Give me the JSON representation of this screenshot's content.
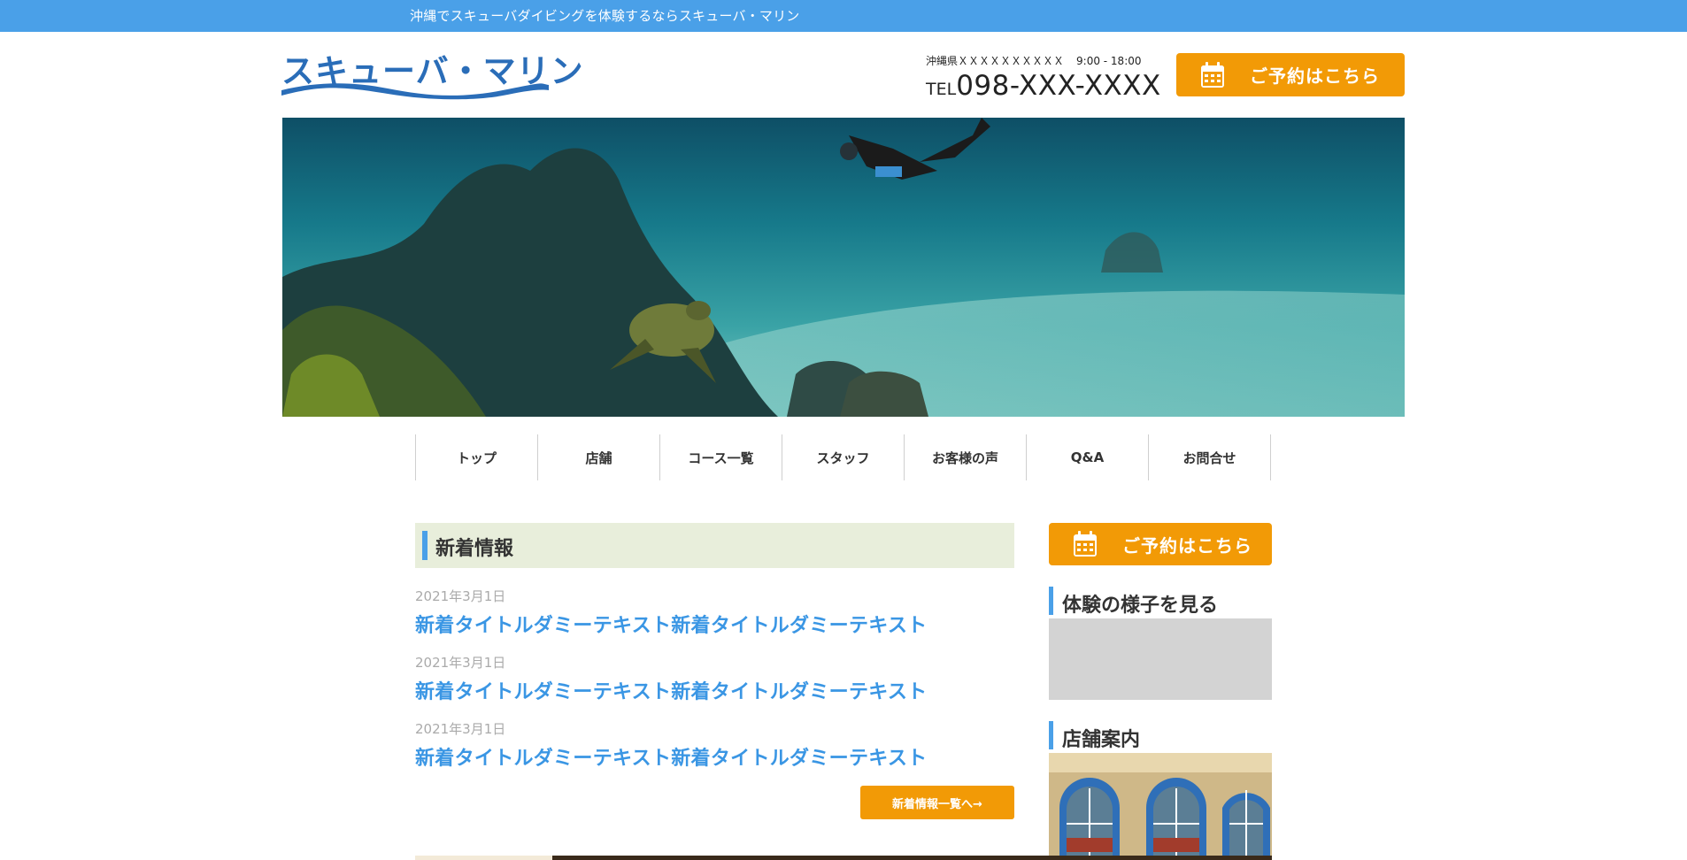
{
  "topbar": {
    "text": "沖縄でスキューバダイビングを体験するならスキューバ・マリン"
  },
  "logo": {
    "text": "スキューバ・マリン"
  },
  "header": {
    "address": "沖縄県ＸＸＸＸＸＸＸＸＸＸ",
    "hours": "9:00 - 18:00",
    "tel_label": "TEL",
    "tel_number": "098-XXX-XXXX",
    "reserve_label": "ご予約はこちら"
  },
  "nav": {
    "items": [
      {
        "label": "トップ"
      },
      {
        "label": "店舗"
      },
      {
        "label": "コース一覧"
      },
      {
        "label": "スタッフ"
      },
      {
        "label": "お客様の声"
      },
      {
        "label": "Q&A"
      },
      {
        "label": "お問合せ"
      }
    ]
  },
  "news": {
    "heading": "新着情報",
    "items": [
      {
        "date": "2021年3月1日",
        "title": "新着タイトルダミーテキスト新着タイトルダミーテキスト"
      },
      {
        "date": "2021年3月1日",
        "title": "新着タイトルダミーテキスト新着タイトルダミーテキスト"
      },
      {
        "date": "2021年3月1日",
        "title": "新着タイトルダミーテキスト新着タイトルダミーテキスト"
      }
    ],
    "more_label": "新着情報一覧へ→"
  },
  "sidebar": {
    "reserve_label": "ご予約はこちら",
    "video_heading": "体験の様子を見る",
    "shop_heading": "店舗案内"
  },
  "colors": {
    "accent_blue": "#4aa0e8",
    "logo_blue": "#2a6db8",
    "orange": "#f29a06",
    "news_bg": "#e8eedb",
    "link_blue": "#3a96e4"
  },
  "icons": {
    "reserve": "calendar-icon"
  }
}
